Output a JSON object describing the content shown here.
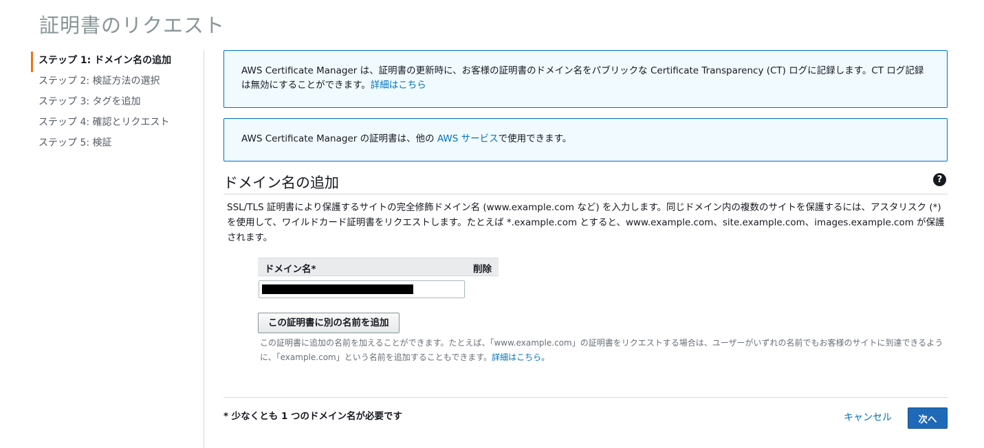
{
  "page": {
    "title": "証明書のリクエスト"
  },
  "steps": [
    {
      "label": "ステップ 1: ドメイン名の追加",
      "active": true
    },
    {
      "label": "ステップ 2: 検証方法の選択"
    },
    {
      "label": "ステップ 3: タグを追加"
    },
    {
      "label": "ステップ 4: 確認とリクエスト"
    },
    {
      "label": "ステップ 5: 検証"
    }
  ],
  "info_ct": {
    "text": "AWS Certificate Manager は、証明書の更新時に、お客様の証明書のドメイン名をパブリックな Certificate Transparency (CT) ログに記録します。CT ログ記録は無効にすることができます。",
    "link": "詳細はこちら"
  },
  "info_services": {
    "text_before": "AWS Certificate Manager の証明書は、他の ",
    "link": "AWS サービス",
    "text_after": "で使用できます。"
  },
  "section": {
    "title": "ドメイン名の追加",
    "help_icon": "?",
    "description": "SSL/TLS 証明書により保護するサイトの完全修飾ドメイン名 (www.example.com など) を入力します。同じドメイン内の複数のサイトを保護するには、アスタリスク (*) を使用して、ワイルドカード証明書をリクエストします。たとえば *.example.com とすると、www.example.com、site.example.com、images.example.com が保護されます。"
  },
  "domain_table": {
    "col_domain": "ドメイン名*",
    "col_delete": "削除",
    "domain_value": ""
  },
  "add_name": {
    "button": "この証明書に別の名前を追加",
    "hint": "この証明書に追加の名前を加えることができます。たとえば、「www.example.com」の証明書をリクエストする場合は、ユーザーがいずれの名前でもお客様のサイトに到達できるように、「example.com」という名前を追加することもできます。",
    "hint_link": "詳細はこちら。"
  },
  "footer": {
    "required_note": "* 少なくとも 1 つのドメイン名が必要です",
    "cancel": "キャンセル",
    "next": "次へ"
  },
  "colors": {
    "accent_step": "#ec7211",
    "link": "#0073bb",
    "primary_button": "#1f69b9",
    "info_bg": "#f1faff"
  }
}
